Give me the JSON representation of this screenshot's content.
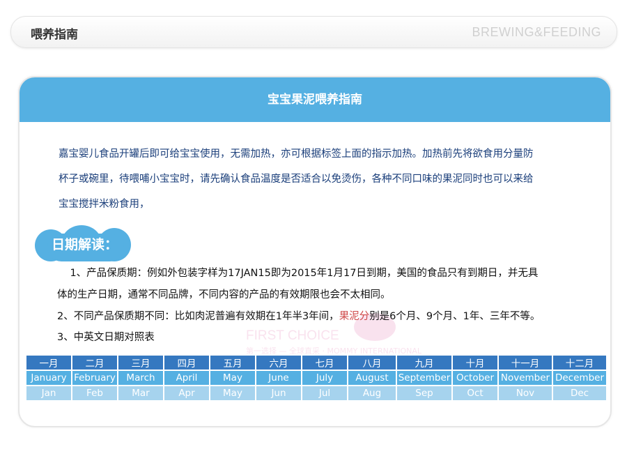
{
  "header": {
    "title": "喂养指南",
    "title_en": "BREWING&FEEDING"
  },
  "card": {
    "title": "宝宝果泥喂养指南",
    "intro_lines": [
      "嘉宝婴儿食品开罐后即可给宝宝使用，无需加热，亦可根据标签上面的指示加热。加热前先将欲食用分量防",
      "杯子或碗里，待喂哺小宝宝时，请先确认食品温度是否适合以免烫伤，各种不同口味的果泥同时也可以来给",
      "宝宝搅拌米粉食用，"
    ],
    "date_section_title": "日期解读：",
    "point1_line1": "1、产品保质期：例如外包装字样为17JAN15即为2015年1月17日到期，美国的食品只有到期日，并无具",
    "point1_line2": "体的生产日期，通常不同品牌，不同内容的产品的有效期限也会不太相同。",
    "point2_before": "2、不同产品保质期不同：比如肉泥普遍有效期在1年半3年间，",
    "point2_highlight": "果泥分",
    "point2_after": "别是6个月、9个月、1年、三年不等。",
    "point3": "3、中英文日期对照表",
    "watermark": {
      "main": "FIRST CHOICE",
      "sub": "第一选择 — 全球直采 · MOMMY INTERNATIONAL"
    }
  },
  "months": {
    "chinese": [
      "一月",
      "二月",
      "三月",
      "四月",
      "五月",
      "六月",
      "七月",
      "八月",
      "九月",
      "十月",
      "十一月",
      "十二月"
    ],
    "english": [
      "January",
      "February",
      "March",
      "April",
      "May",
      "June",
      "July",
      "August",
      "September",
      "October",
      "November",
      "December"
    ],
    "abbr": [
      "Jan",
      "Feb",
      "Mar",
      "Apr",
      "May",
      "Jun",
      "Jul",
      "Aug",
      "Sep",
      "Oct",
      "Nov",
      "Dec"
    ]
  },
  "colors": {
    "accent": "#55b0e2",
    "dark_blue": "#3578c0",
    "light_blue": "#a6d3ee",
    "intro_text": "#1a3e7a",
    "highlight": "#cf4848"
  }
}
